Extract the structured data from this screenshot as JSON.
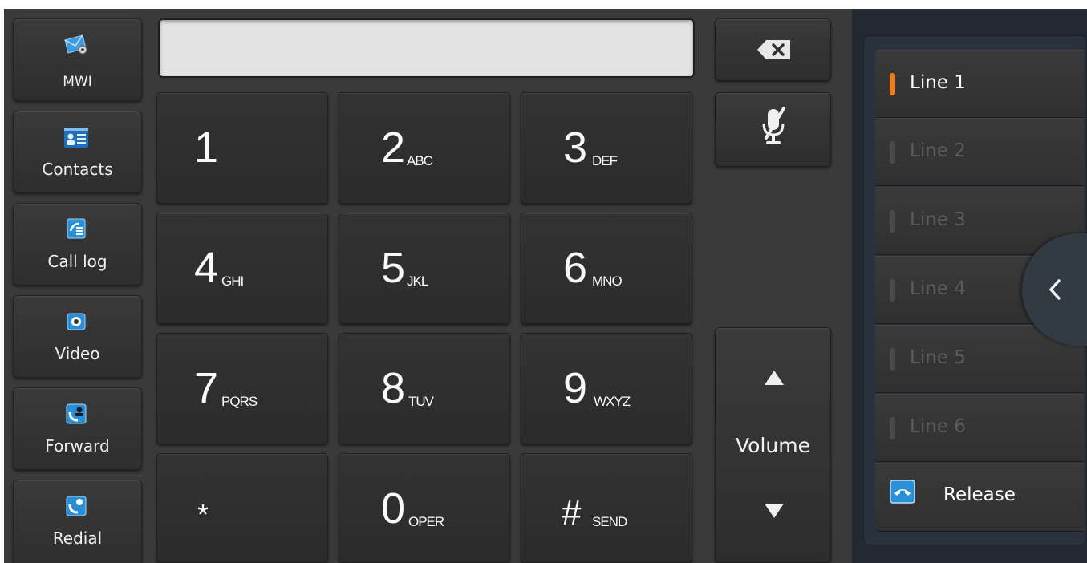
{
  "softkeys": [
    {
      "label": "MWI",
      "icon": "voicemail-icon"
    },
    {
      "label": "Contacts",
      "icon": "contacts-icon"
    },
    {
      "label": "Call log",
      "icon": "call-log-icon"
    },
    {
      "label": "Video",
      "icon": "video-icon"
    },
    {
      "label": "Forward",
      "icon": "forward-icon"
    },
    {
      "label": "Redial",
      "icon": "redial-icon"
    }
  ],
  "display": {
    "value": ""
  },
  "keypad": [
    {
      "digit": "1",
      "letters": ""
    },
    {
      "digit": "2",
      "letters": "ABC"
    },
    {
      "digit": "3",
      "letters": "DEF"
    },
    {
      "digit": "4",
      "letters": "GHI"
    },
    {
      "digit": "5",
      "letters": "JKL"
    },
    {
      "digit": "6",
      "letters": "MNO"
    },
    {
      "digit": "7",
      "letters": "PQRS"
    },
    {
      "digit": "8",
      "letters": "TUV"
    },
    {
      "digit": "9",
      "letters": "WXYZ"
    },
    {
      "digit": "*",
      "letters": ""
    },
    {
      "digit": "0",
      "letters": "OPER"
    },
    {
      "digit": "#",
      "letters": "SEND"
    }
  ],
  "volume": {
    "label": "Volume"
  },
  "lines": [
    {
      "label": "Line 1",
      "active": true
    },
    {
      "label": "Line 2",
      "active": false
    },
    {
      "label": "Line 3",
      "active": false
    },
    {
      "label": "Line 4",
      "active": false
    },
    {
      "label": "Line 5",
      "active": false
    },
    {
      "label": "Line 6",
      "active": false
    }
  ],
  "release": {
    "label": "Release"
  },
  "colors": {
    "active_line_indicator": "#f07d1a",
    "active_line_text": "#ffffff",
    "inactive_line_text": "#5c5c5c",
    "accent_blue": "#2a8fd6"
  }
}
